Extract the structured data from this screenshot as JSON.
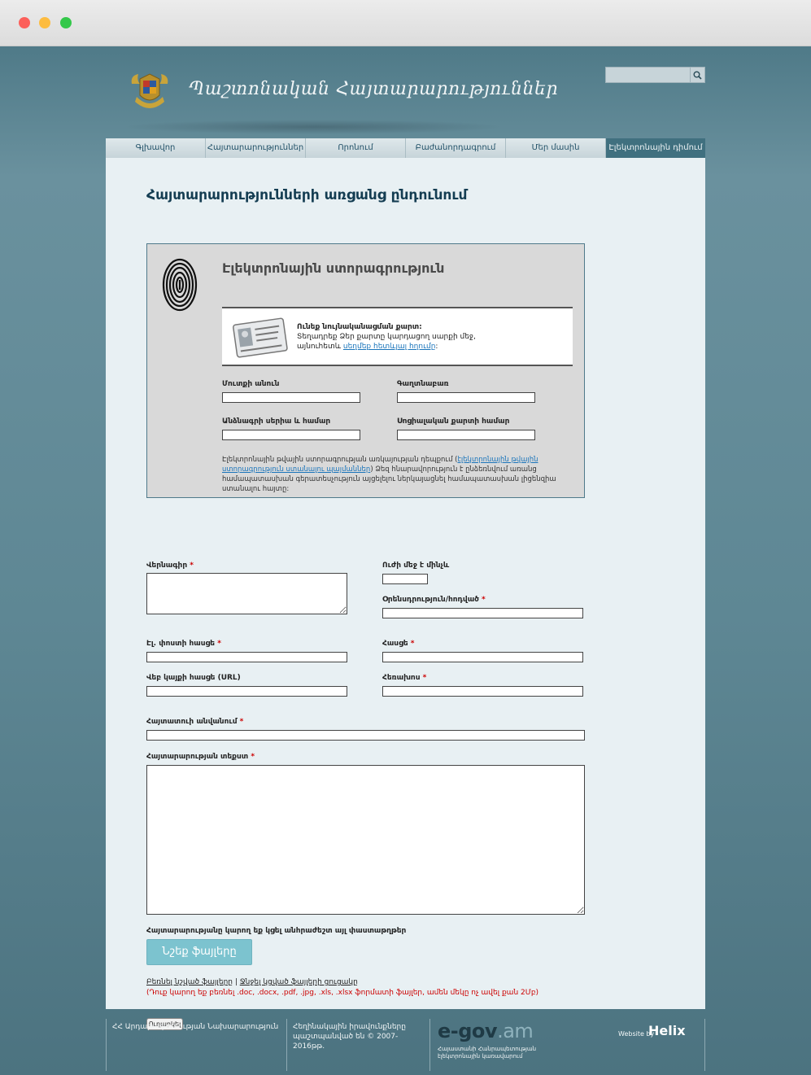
{
  "header": {
    "site_title": "Պաշտոնական Հայտարարություններ",
    "search_placeholder": ""
  },
  "nav": [
    {
      "label": "Գլխավոր",
      "active": false
    },
    {
      "label": "Հայտարարություններ",
      "active": false
    },
    {
      "label": "Որոնում",
      "active": false
    },
    {
      "label": "Բաժանորդագրում",
      "active": false
    },
    {
      "label": "Մեր մասին",
      "active": false
    },
    {
      "label": "Էլեկտրոնային դիմում",
      "active": true
    }
  ],
  "page": {
    "title": "Հայտարարությունների առցանց ընդունում"
  },
  "esign": {
    "title": "Էլեկտրոնային ստորագրություն",
    "id_line1": "Ունեք նույնականացման քարտ:",
    "id_line2": "Տեղադրեք Ձեր քարտը կարդացող սարքի մեջ,",
    "id_line3_prefix": "այնուհետև ",
    "id_line3_link": "սեղմեք հետևյալ հղումը",
    "id_line3_suffix": ":",
    "login_label": "Մուտքի անուն",
    "password_label": "Գաղտնաբառ",
    "passport_label": "Անձնագրի սերիա և համար",
    "social_card_label": "Սոցիալական քարտի համար",
    "note_prefix": "Էլեկտրոնային թվային ստորագրության առկայության դեպքում (",
    "note_link": "էլեկտրոնային թվային ստորագրություն ստանալու պայմաններ",
    "note_suffix": ") Ձեզ հնարավորություն է ընձեռնվում առանց համապատասխան գերատեսչություն այցելելու ներկայացնել համապատասխան լիցենզիա ստանալու հայտը:"
  },
  "form": {
    "title_label": "Վերնագիր",
    "valid_until_label": "Ուժի մեջ է մինչև",
    "law_label": "Օրենսդրություն/հոդված",
    "email_label": "Էլ. փոստի հասցե",
    "address_label": "Հասցե",
    "website_label": "Վեբ կայքի հասցե (URL)",
    "phone_label": "Հեռախոս",
    "announcer_label": "Հայտատուի անվանում",
    "text_label": "Հայտարարության տեքստ",
    "required_mark": "*",
    "attach_note": "Հայտարարությանը կարող եք կցել անհրաժեշտ այլ փաստաթղթեր",
    "upload_button": "Նշեք ֆայլերը",
    "open_files_link": "Բեռնել նշված ֆայլերը",
    "separator": " | ",
    "clear_files_link": "Ջնջել կցված ֆայլերի ցուցակը",
    "files_note": "(Դուք կարող եք բեռնել .doc, .docx, .pdf, .jpg, .xls, .xlsx ֆորմատի ֆայլեր, ամեն մեկը ոչ ավել քան 2Մբ)",
    "submit_button": "Ուղարկել"
  },
  "footer": {
    "ministry": "ՀՀ Արդարադատության Նախարարություն",
    "copyright": "Հեղինակային իրավունքները պաշտպանված են © 2007-2016թթ.",
    "egov_main": "e-gov",
    "egov_am": ".am",
    "egov_sub": "Հայաստանի Հանրապետության էլեկտրոնային կառավարում",
    "website_by": "Website by",
    "helix": "Helix"
  },
  "colors": {
    "accent": "#40707f",
    "link": "#1b75bb",
    "required": "#cc0000",
    "button": "#7cc3cf"
  }
}
